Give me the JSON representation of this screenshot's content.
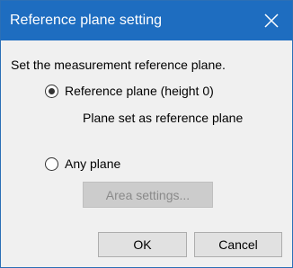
{
  "dialog": {
    "title": "Reference plane setting",
    "close_icon": "close-icon",
    "instruction": "Set the measurement reference plane.",
    "options": [
      {
        "label": "Reference plane (height 0)",
        "selected": true
      },
      {
        "label": "Any plane",
        "selected": false
      }
    ],
    "reference_hint": "Plane set as reference plane",
    "area_settings_label": "Area settings...",
    "area_settings_enabled": false,
    "ok_label": "OK",
    "cancel_label": "Cancel"
  },
  "colors": {
    "titlebar": "#1e6dc0",
    "body": "#f0f0f0",
    "button": "#e1e1e1",
    "button_border": "#adadad",
    "disabled_text": "#8a8a8a"
  }
}
